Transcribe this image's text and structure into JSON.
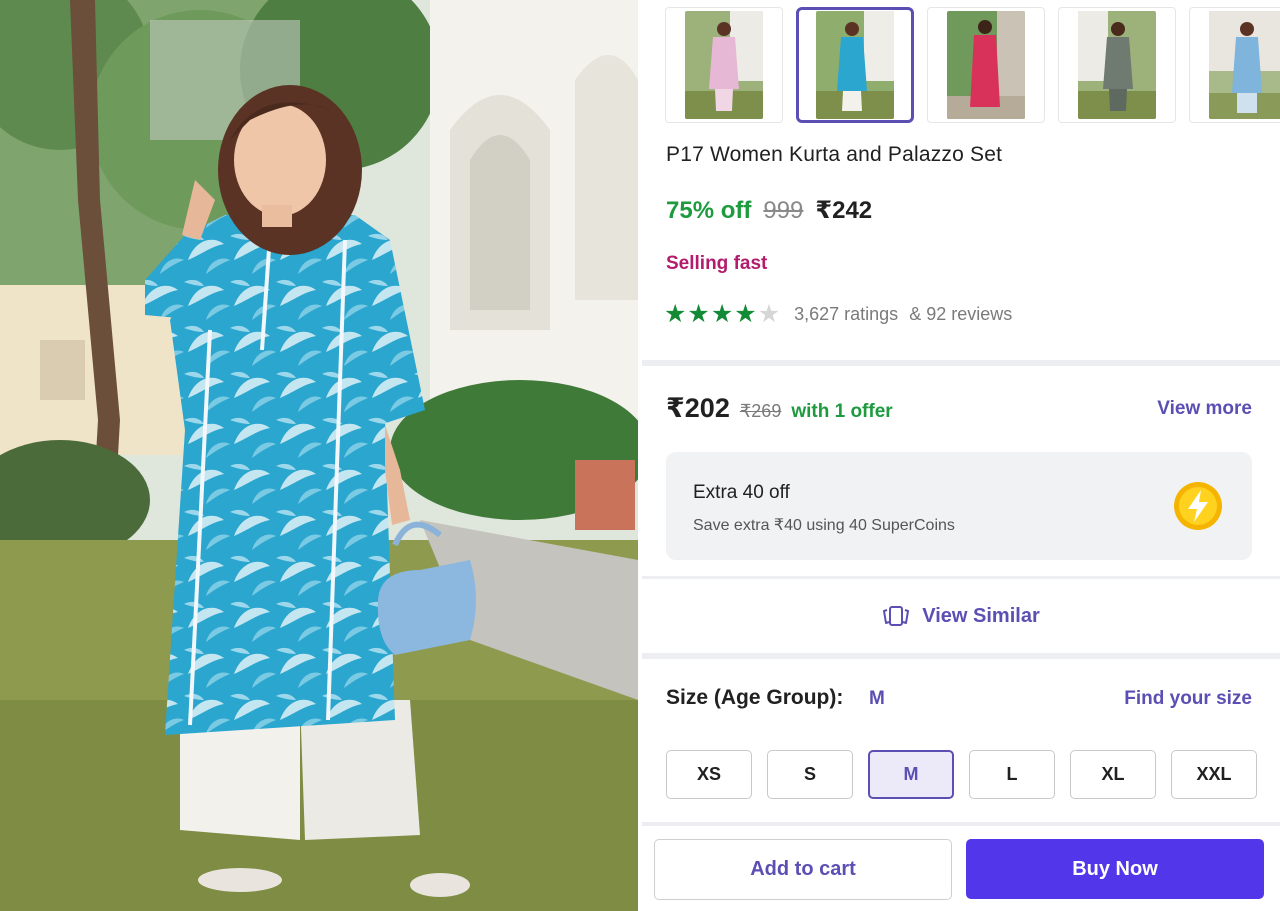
{
  "product": {
    "title": "P17 Women Kurta and Palazzo Set",
    "discount": "75% off",
    "mrp": "999",
    "price": "₹242",
    "stock_status": "Selling fast",
    "rating_stars": 4,
    "ratings_count": "3,627 ratings",
    "reviews_count": "& 92 reviews",
    "thumbnail_count": 5,
    "selected_thumbnail": 2
  },
  "offer": {
    "price": "₹202",
    "mrp": "₹269",
    "note": "with 1 offer",
    "view_more_label": "View more"
  },
  "supercoins": {
    "title": "Extra 40 off",
    "subtitle": "Save extra ₹40 using 40 SuperCoins",
    "icon": "lightning-coin-icon"
  },
  "view_similar": {
    "label": "View Similar",
    "icon": "cards-stack-icon"
  },
  "size": {
    "heading": "Size (Age Group):",
    "selected": "M",
    "find_label": "Find your size",
    "options": [
      "XS",
      "S",
      "M",
      "L",
      "XL",
      "XXL"
    ]
  },
  "actions": {
    "add_to_cart": "Add to cart",
    "buy_now": "Buy Now"
  },
  "colors": {
    "accent": "#5b4fb3",
    "buy_button": "#5236ea",
    "discount_green": "#1e9a3f",
    "selling_fast": "#b31b6b",
    "star": "#138a36"
  }
}
